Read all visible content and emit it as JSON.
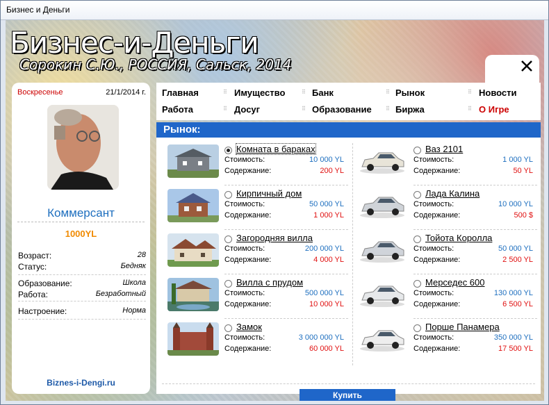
{
  "window": {
    "title": "Бизнес и Деньги"
  },
  "header": {
    "brand": "Бизнес-и-Деньги",
    "subtitle": "Сорокин С.Ю., РОССИЯ, Сальск, 2014"
  },
  "profile": {
    "day": "Воскресенье",
    "date": "21/1/2014 г.",
    "rank": "Коммерсант",
    "money": "1000YL",
    "stats": [
      {
        "k": "Возраст:",
        "v": "28"
      },
      {
        "k": "Статус:",
        "v": "Бедняк"
      },
      {
        "k": "Образование:",
        "v": "Школа"
      },
      {
        "k": "Работа:",
        "v": "Безработный"
      },
      {
        "k": "Настроение:",
        "v": "Норма"
      }
    ],
    "site": "Biznes-i-Dengi.ru"
  },
  "nav": {
    "row1": [
      "Главная",
      "Имущество",
      "Банк",
      "Рынок",
      "Новости"
    ],
    "row2": [
      "Работа",
      "Досуг",
      "Образование",
      "Биржа",
      "О Игре"
    ]
  },
  "market": {
    "title": "Рынок:",
    "cost_label": "Стоимость:",
    "upkeep_label": "Содержание:",
    "buy": "Купить",
    "houses": [
      {
        "name": "Комната в бараках",
        "cost": "10 000 YL",
        "upkeep": "200 YL"
      },
      {
        "name": "Кирпичный дом",
        "cost": "50 000 YL",
        "upkeep": "1 000 YL"
      },
      {
        "name": "Загородняя вилла",
        "cost": "200 000 YL",
        "upkeep": "4 000 YL"
      },
      {
        "name": "Вилла с прудом",
        "cost": "500 000 YL",
        "upkeep": "10 000 YL"
      },
      {
        "name": "Замок",
        "cost": "3 000 000 YL",
        "upkeep": "60 000 YL"
      }
    ],
    "cars": [
      {
        "name": "Ваз 2101",
        "cost": "1 000 YL",
        "upkeep": "50 YL"
      },
      {
        "name": "Лада Калина",
        "cost": "10 000 YL",
        "upkeep": "500 $"
      },
      {
        "name": "Тойота Королла",
        "cost": "50 000 YL",
        "upkeep": "2 500 YL"
      },
      {
        "name": "Мерседес 600",
        "cost": "130 000 YL",
        "upkeep": "6 500 YL"
      },
      {
        "name": "Порше Панамера",
        "cost": "350 000 YL",
        "upkeep": "17 500 YL"
      }
    ]
  }
}
